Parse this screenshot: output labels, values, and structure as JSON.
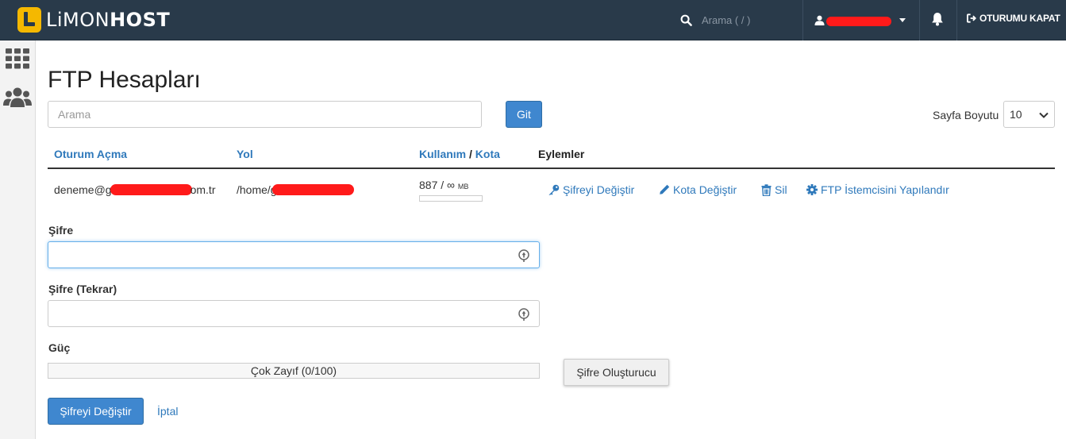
{
  "brand": {
    "name_light": "LiMON",
    "name_bold": "HOST",
    "accent": "#f5b800",
    "topbar_bg": "#293a4a"
  },
  "topbar": {
    "search_placeholder": "Arama ( / )",
    "logout_label": "OTURUMU KAPAT",
    "icons": {
      "search": "search-icon",
      "user": "user-icon",
      "bell": "bell-icon",
      "logout": "sign-out-icon"
    }
  },
  "sidebar": {
    "items": [
      {
        "icon": "grid-icon"
      },
      {
        "icon": "users-icon"
      }
    ]
  },
  "page": {
    "title": "FTP Hesapları",
    "search_placeholder": "Arama",
    "go_button": "Git",
    "page_size_label": "Sayfa Boyutu",
    "page_size_value": "10"
  },
  "table": {
    "headers": {
      "login": "Oturum Açma",
      "path": "Yol",
      "usage": "Kullanım",
      "separator": "/",
      "quota": "Kota",
      "actions": "Eylemler"
    },
    "row": {
      "login_prefix": "deneme@g",
      "login_suffix": "om.tr",
      "path_prefix": "/home/g",
      "usage_value": "887",
      "usage_sep": "/",
      "usage_quota": "∞",
      "usage_unit": "MB",
      "usage_fraction": 0
    },
    "actions": {
      "change_password": "Şifreyi Değiştir",
      "change_quota": "Kota Değiştir",
      "delete": "Sil",
      "configure_client": "FTP İstemcisini Yapılandır"
    }
  },
  "form": {
    "password_label": "Şifre",
    "password_value": "",
    "password_repeat_label": "Şifre (Tekrar)",
    "password_repeat_value": "",
    "strength_label": "Güç",
    "strength_text": "Çok Zayıf (0/100)",
    "strength_value": 0,
    "generator_button": "Şifre Oluşturucu",
    "submit_button": "Şifreyi Değiştir",
    "cancel_link": "İptal"
  }
}
